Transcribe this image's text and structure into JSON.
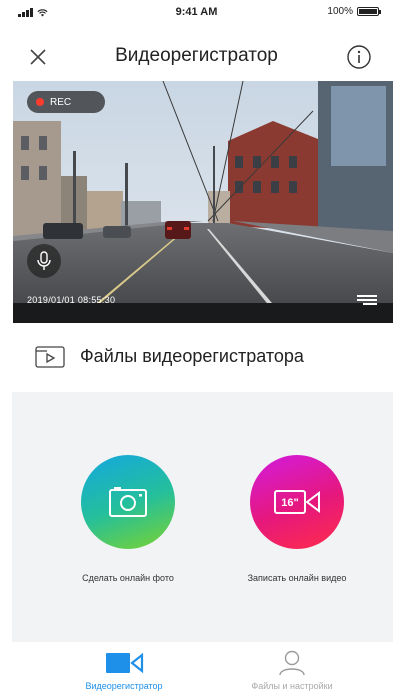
{
  "status_bar": {
    "time": "9:41 AM",
    "battery_percent": "100%",
    "battery_level": 1.0,
    "icons": [
      "signal-icon",
      "wifi-icon",
      "battery-icon"
    ]
  },
  "nav": {
    "title": "Видеорегистратор",
    "close_icon": "close-icon",
    "info_icon": "info-icon"
  },
  "video": {
    "rec_label": "REC",
    "timestamp": "2019/01/01   08:55:30",
    "mic_icon": "microphone-icon"
  },
  "files_link": {
    "label": "Файлы видеорегистратора",
    "icon": "video-file-icon"
  },
  "actions": {
    "photo_label": "Сделать онлайн фото",
    "photo_icon": "camera-icon",
    "video_label": "Записать онлайн видео",
    "video_badge": "16\"",
    "video_icon": "video-camera-icon"
  },
  "tabs": [
    {
      "label": "Видеорегистратор",
      "icon": "dashcam-icon",
      "active": true
    },
    {
      "label": "Файлы и настройки",
      "icon": "person-icon",
      "active": false
    }
  ],
  "colors": {
    "accent": "#1e90ea",
    "rec_red": "#ff3b30",
    "photo_gradient": [
      "#14a7e0",
      "#24bf9c",
      "#7bd32d"
    ],
    "video_gradient": [
      "#d21be0",
      "#e6187c",
      "#ff2c4a"
    ],
    "panel_bg": "#f1f3f5"
  }
}
